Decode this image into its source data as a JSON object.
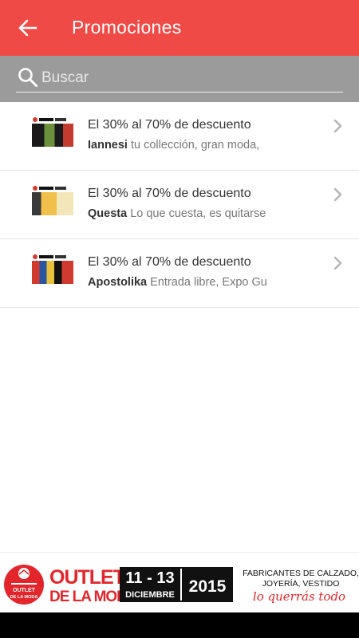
{
  "appbar": {
    "title": "Promociones",
    "color": "#f04a46",
    "back_icon": "arrow-left-icon"
  },
  "search": {
    "placeholder": "Buscar",
    "value": "",
    "icon": "search-icon"
  },
  "promotions": [
    {
      "title": "El 30% al 70% de descuento",
      "brand": "Iannesi",
      "description": "tu collección, gran moda,",
      "thumb_colors": [
        "#1a1a1a",
        "#6b8f3a",
        "#c23b2e"
      ]
    },
    {
      "title": "El 30% al 70% de descuento",
      "brand": "Questa",
      "description": "Lo que cuesta, es quitarse",
      "thumb_colors": [
        "#f0c04a",
        "#e4a94a",
        "#f3e6b8"
      ]
    },
    {
      "title": "El 30% al 70% de descuento",
      "brand": "Apostolika",
      "description": "Entrada libre, Expo Gu",
      "thumb_colors": [
        "#d13b2f",
        "#2b55a0",
        "#e8c23a"
      ]
    }
  ],
  "banner": {
    "brand_line1": "OUTLET",
    "brand_line2": "DE LA MODA",
    "badge_text": "OUTLET DE LA MODA",
    "dates": "11 - 13",
    "month": "DICIEMBRE",
    "year": "2015",
    "info_line1": "FABRICANTES DE CALZADO,",
    "info_line2": "JOYERÍA, VESTIDO",
    "slogan": "lo querrás todo",
    "accent_color": "#e2262b"
  }
}
